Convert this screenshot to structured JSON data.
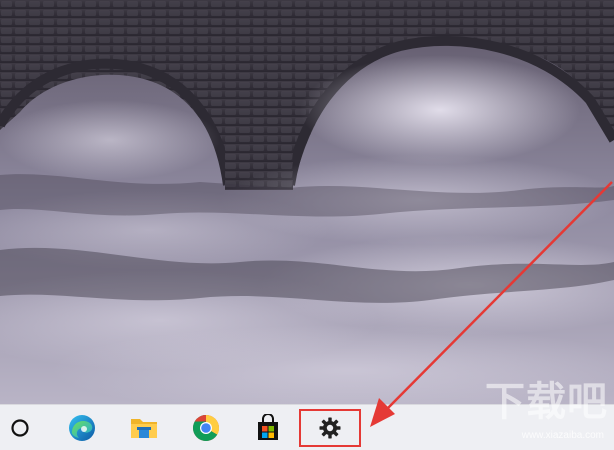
{
  "taskbar": {
    "apps": [
      {
        "id": "search",
        "icon": "cortana-circle-icon"
      },
      {
        "id": "edge",
        "icon": "edge-icon"
      },
      {
        "id": "file-explorer",
        "icon": "folder-icon"
      },
      {
        "id": "chrome",
        "icon": "chrome-icon"
      },
      {
        "id": "store",
        "icon": "microsoft-store-icon"
      },
      {
        "id": "settings",
        "icon": "gear-icon"
      }
    ],
    "background": "#eeeff3"
  },
  "annotation": {
    "highlight_color": "#e53935",
    "highlighted_item": "settings"
  },
  "watermark": {
    "title": "下载吧",
    "url": "www.xiazaiba.com"
  }
}
